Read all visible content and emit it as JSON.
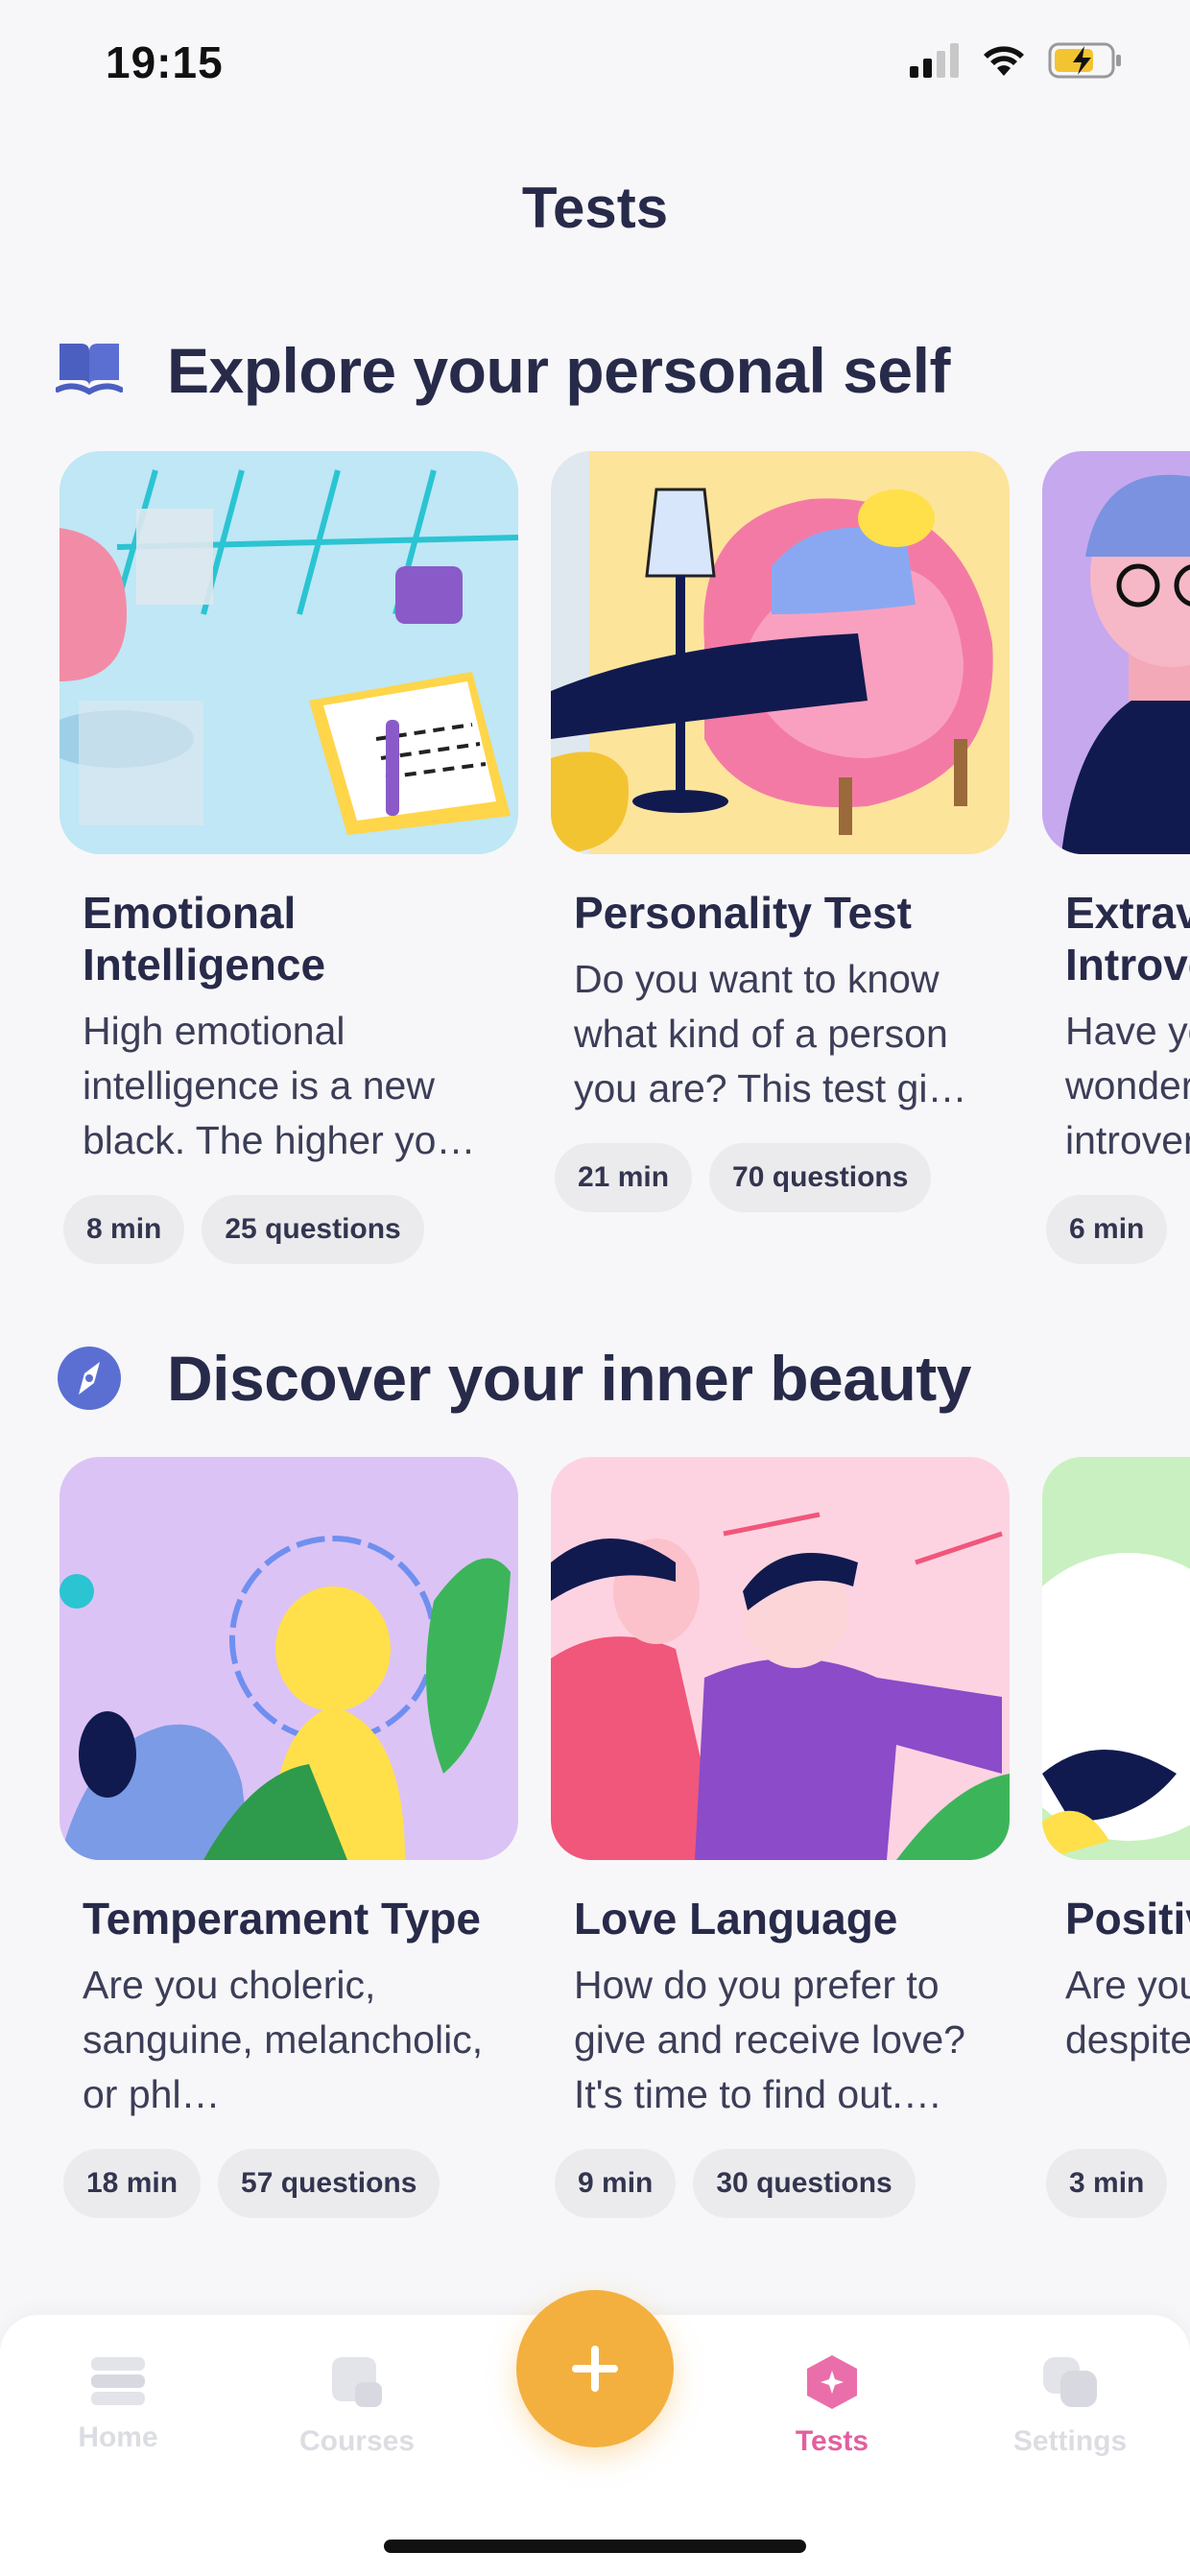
{
  "status": {
    "time": "19:15"
  },
  "page": {
    "title": "Tests"
  },
  "sections": [
    {
      "icon": "book-icon",
      "title": "Explore your personal self",
      "cards": [
        {
          "title": "Emotional Intelligence",
          "desc": "High emotional intelligence is a new black. The higher yo…",
          "chips": [
            "8 min",
            "25 questions"
          ]
        },
        {
          "title": "Personality Test",
          "desc": "Do you want to know what kind of a person you are? This test gi…",
          "chips": [
            "21 min",
            "70 questions"
          ]
        },
        {
          "title": "Extraversion Introversion",
          "desc": "Have you ever wondered if you are an introvert…",
          "chips": [
            "6 min",
            ""
          ]
        }
      ]
    },
    {
      "icon": "compass-icon",
      "title": "Discover your inner beauty",
      "cards": [
        {
          "title": "Temperament Type",
          "desc": "Are you choleric, sanguine, melancholic, or phl…",
          "chips": [
            "18 min",
            "57 questions"
          ]
        },
        {
          "title": "Love Language",
          "desc": "How do you prefer to give and receive love? It's time to find out.…",
          "chips": [
            "9 min",
            "30 questions"
          ]
        },
        {
          "title": "Positive Outlook",
          "desc": "Are you good vibe despite sadness…",
          "chips": [
            "3 min",
            ""
          ]
        }
      ]
    }
  ],
  "nav": {
    "home": "Home",
    "courses": "Courses",
    "tests": "Tests",
    "settings": "Settings",
    "fab": "+"
  },
  "colors": {
    "accent": "#f3b03f",
    "active_tab": "#e2609e",
    "heading": "#282a4a"
  }
}
